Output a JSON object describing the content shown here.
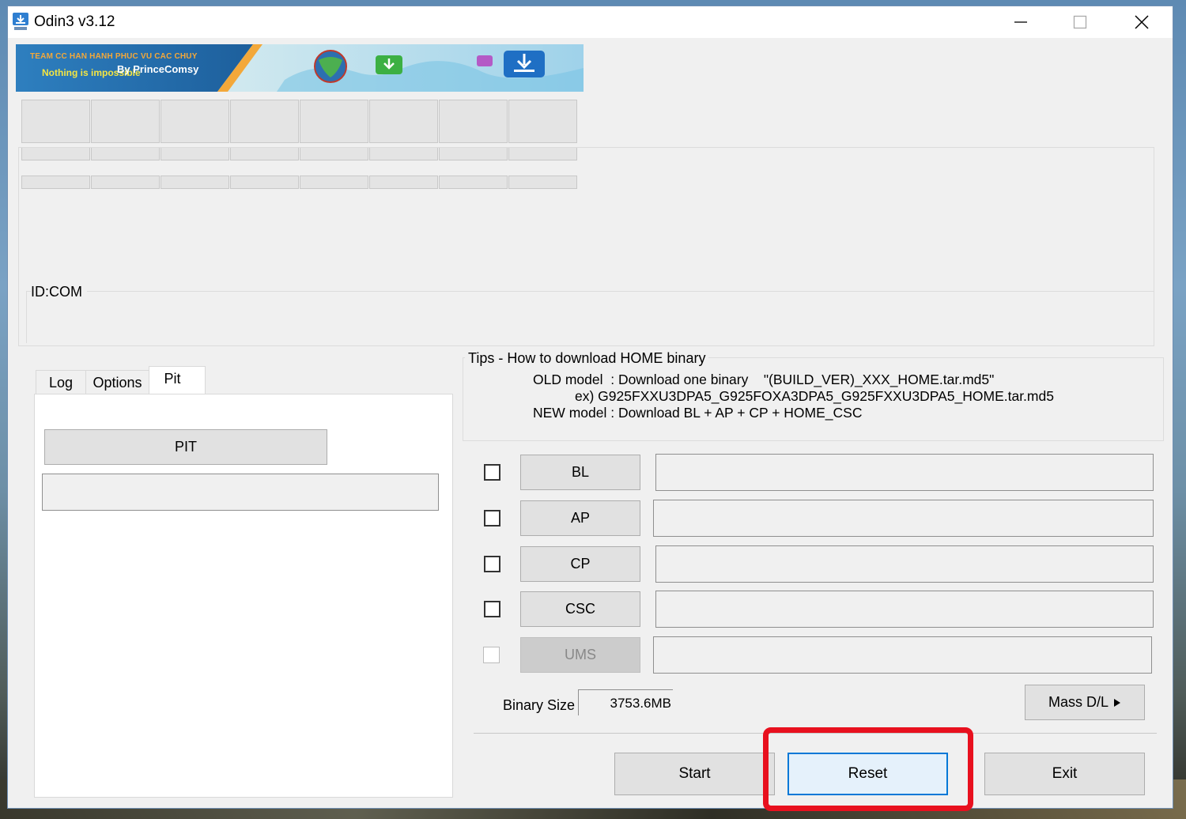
{
  "window": {
    "title": "Odin3 v3.12",
    "icons": {
      "app": "odin-download-icon",
      "minimize": "minimize-icon",
      "maximize": "maximize-icon",
      "close": "close-icon"
    }
  },
  "banner": {
    "line1": "TEAM CC HAN HANH PHUC VU CAC CHUY",
    "line2": "Nothing is impossible",
    "line3": "By PrinceComsy",
    "colors": {
      "orange": "#f3a83a",
      "yellow": "#f5e642",
      "sky": "#bfe6f3"
    }
  },
  "id_com": {
    "label": "ID:COM"
  },
  "tabs": [
    {
      "label": "Log"
    },
    {
      "label": "Options"
    },
    {
      "label": "Pit",
      "active": true
    }
  ],
  "pit": {
    "button_label": "PIT",
    "field_value": ""
  },
  "tips": {
    "title": "Tips - How to download HOME binary",
    "line1": "OLD model  : Download one binary    \"(BUILD_VER)_XXX_HOME.tar.md5\"",
    "line2": "ex) G925FXXU3DPA5_G925FOXA3DPA5_G925FXXU3DPA5_HOME.tar.md5",
    "line3": "NEW model : Download BL + AP + CP + HOME_CSC"
  },
  "files": [
    {
      "label": "BL",
      "checked": false,
      "enabled": true,
      "value": ""
    },
    {
      "label": "AP",
      "checked": false,
      "enabled": true,
      "value": ""
    },
    {
      "label": "CP",
      "checked": false,
      "enabled": true,
      "value": ""
    },
    {
      "label": "CSC",
      "checked": false,
      "enabled": true,
      "value": ""
    },
    {
      "label": "UMS",
      "checked": false,
      "enabled": false,
      "value": ""
    }
  ],
  "binary_size": {
    "label": "Binary Size",
    "value": "3753.6MB"
  },
  "mass_dl": {
    "label": "Mass D/L",
    "icon": "play-arrow-icon"
  },
  "actions": {
    "start": "Start",
    "reset": "Reset",
    "exit": "Exit"
  },
  "annotation": {
    "color": "#e8101e",
    "target": "reset-button"
  }
}
